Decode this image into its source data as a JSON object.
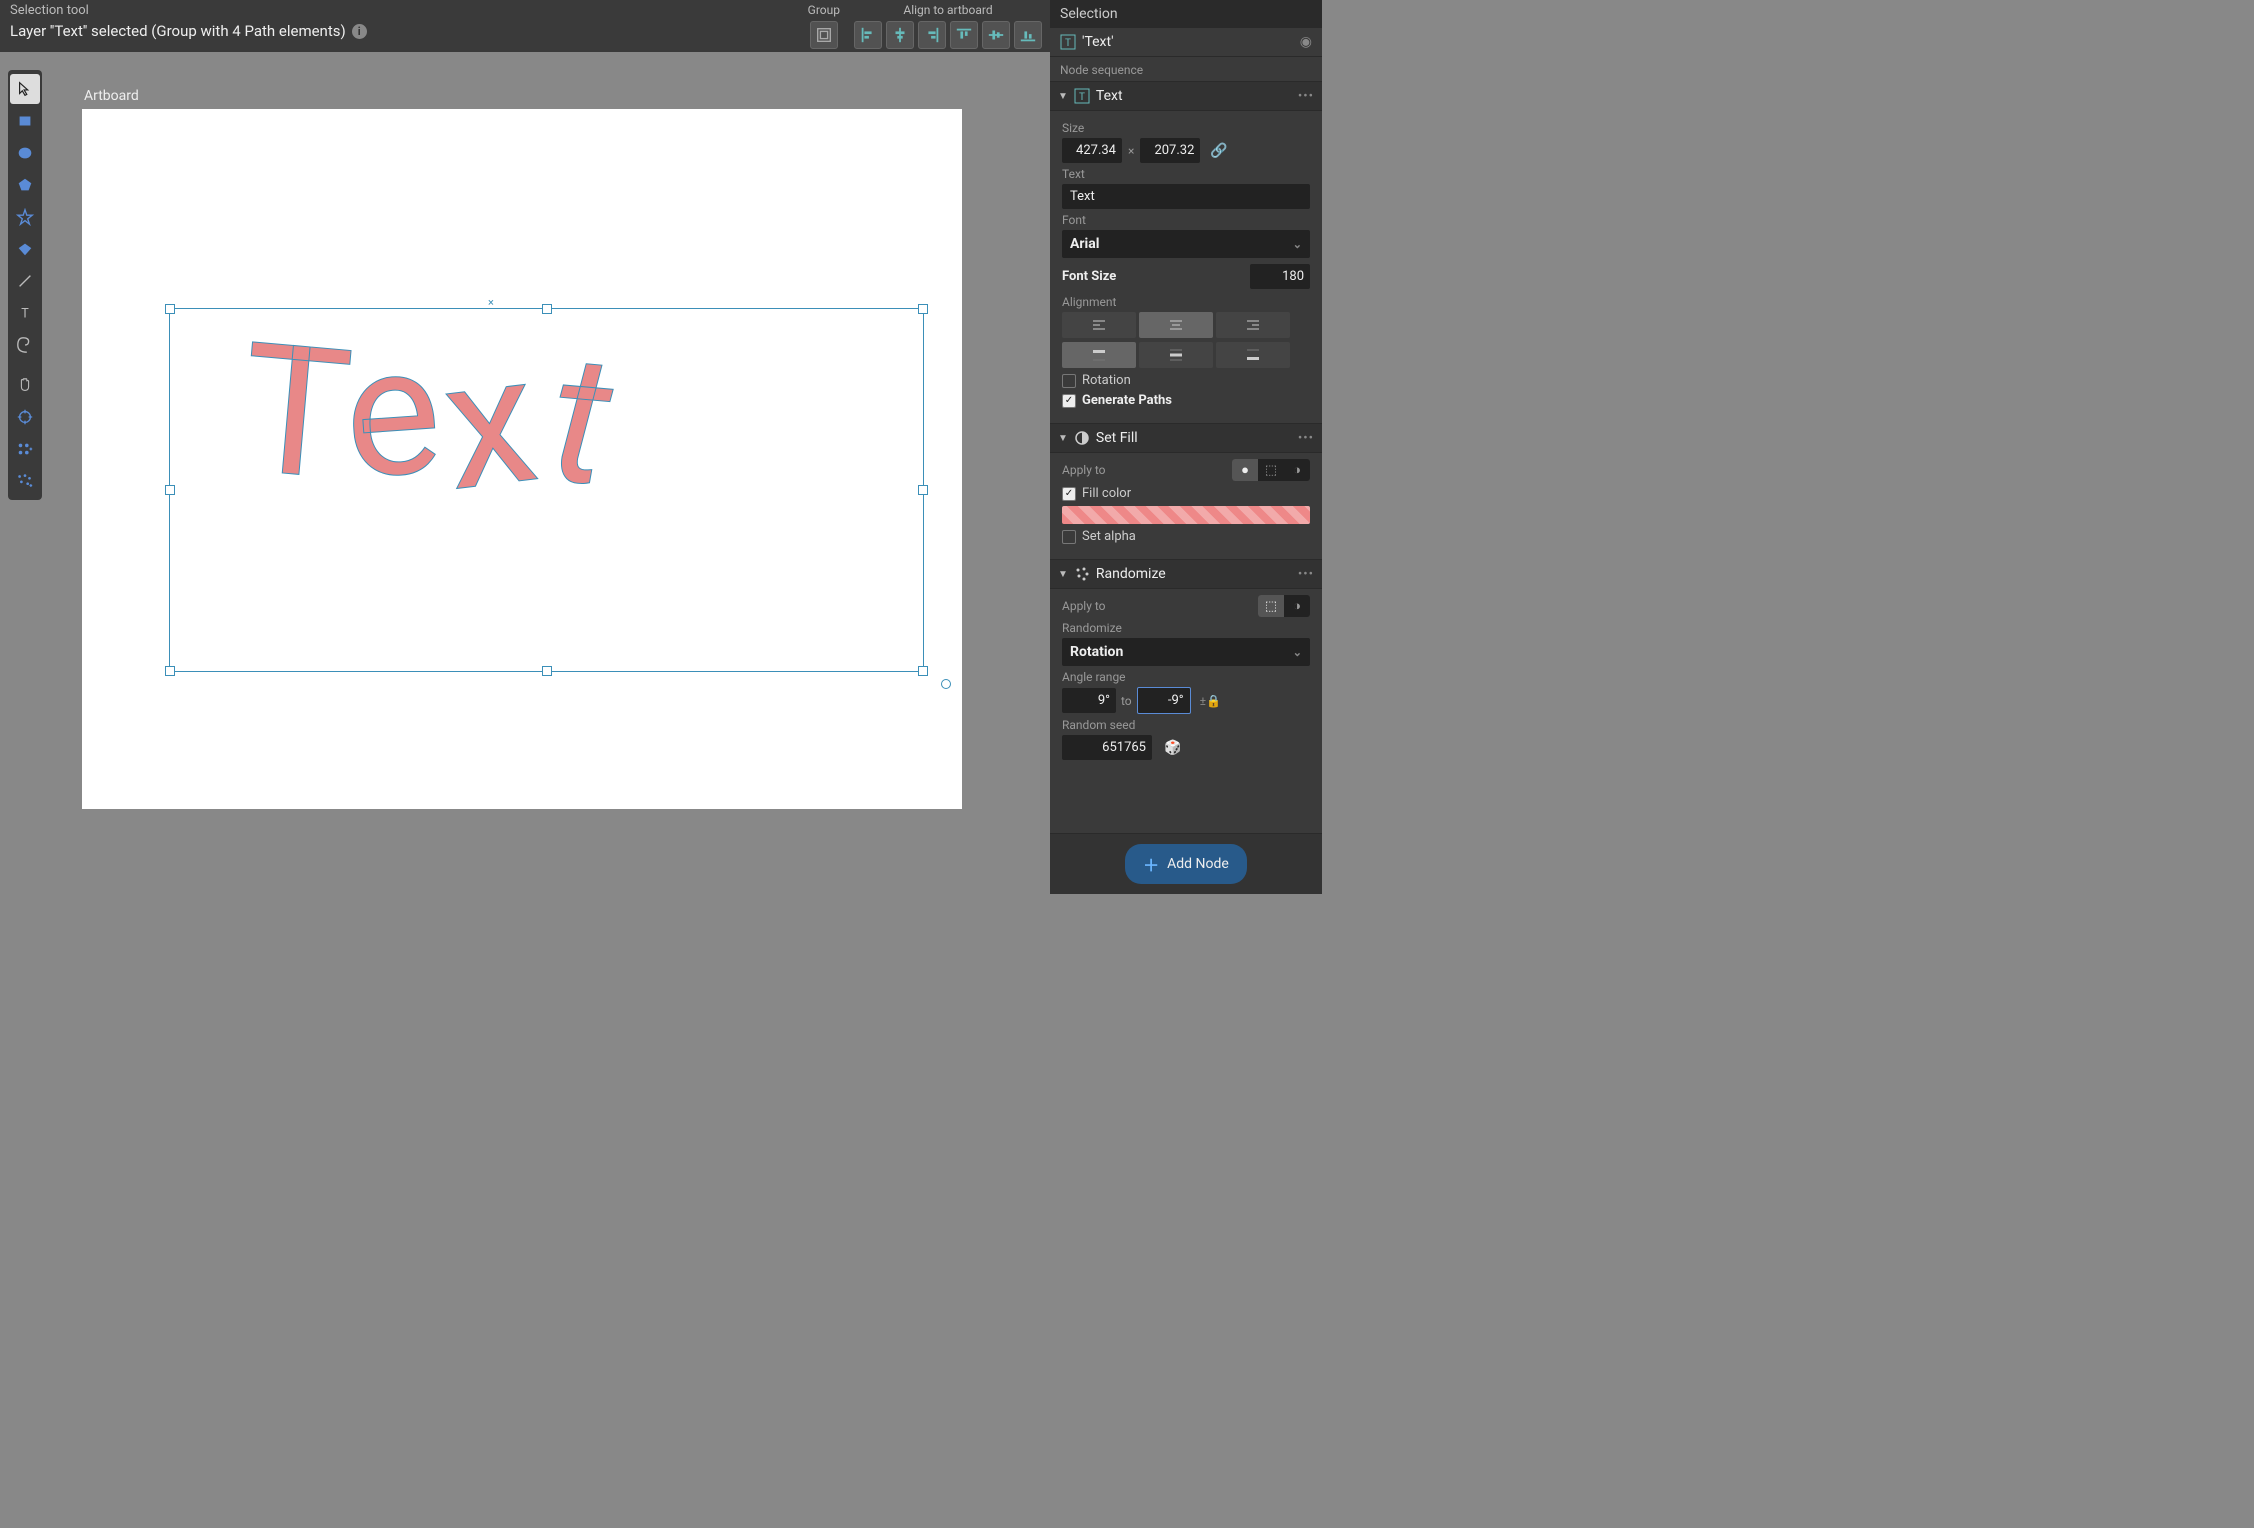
{
  "topbar": {
    "tool_label": "Selection tool",
    "status": "Layer ''Text'' selected (Group with 4 Path elements)",
    "group_label": "Group",
    "align_label": "Align to artboard"
  },
  "toolbar_tools": [
    "select",
    "rect",
    "ellipse",
    "polygon",
    "star",
    "diamond",
    "line",
    "text",
    "spiral",
    "pan",
    "transform",
    "distribute",
    "randomize"
  ],
  "canvas": {
    "artboard_label": "Artboard",
    "text_value": "Text"
  },
  "panel": {
    "header": "Selection",
    "object_name": "'Text'",
    "subheader": "Node sequence",
    "text_node": {
      "title": "Text",
      "size_label": "Size",
      "width": "427.34",
      "height": "207.32",
      "text_label": "Text",
      "text_value": "Text",
      "font_label": "Font",
      "font_value": "Arial",
      "fontsize_label": "Font Size",
      "fontsize_value": "180",
      "alignment_label": "Alignment",
      "rotation_label": "Rotation",
      "generate_label": "Generate Paths"
    },
    "setfill": {
      "title": "Set Fill",
      "apply_label": "Apply to",
      "fill_label": "Fill color",
      "alpha_label": "Set alpha"
    },
    "randomize": {
      "title": "Randomize",
      "apply_label": "Apply to",
      "randomize_label": "Randomize",
      "select_value": "Rotation",
      "angle_label": "Angle range",
      "angle_from": "9°",
      "angle_to_label": "to",
      "angle_to": "-9°",
      "seed_label": "Random seed",
      "seed_value": "651765"
    },
    "add_node": "Add Node"
  }
}
